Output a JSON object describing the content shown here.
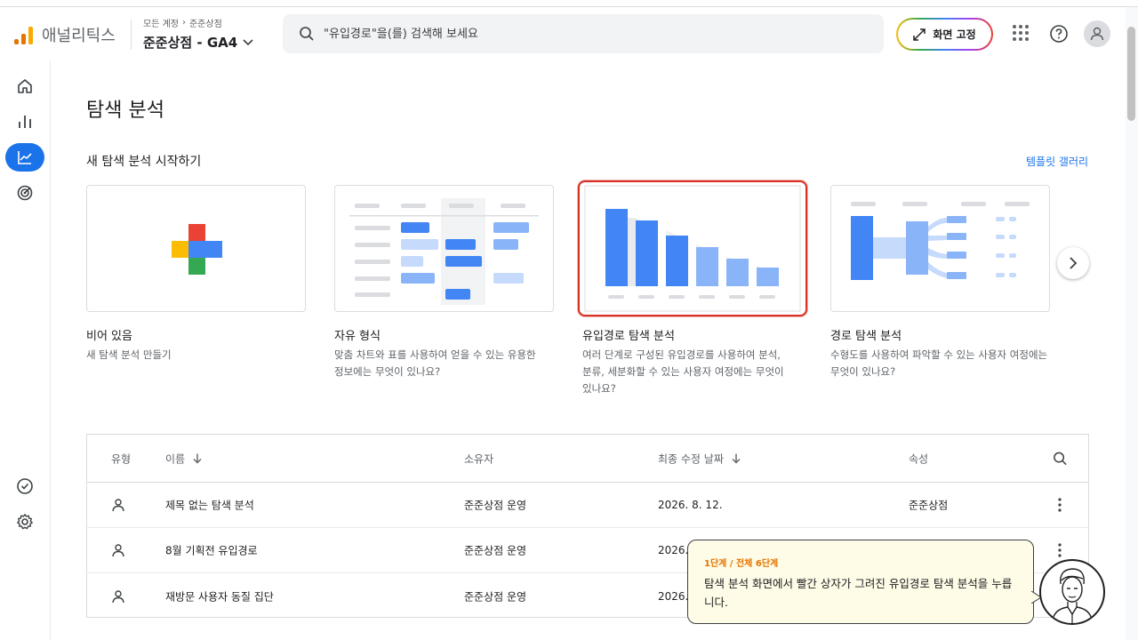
{
  "header": {
    "app_name": "애널리틱스",
    "breadcrumb": [
      "모든 계정",
      "준준상점"
    ],
    "property_name": "준준상점 - GA4",
    "search_placeholder": "\"유입경로\"을(를) 검색해 보세요",
    "pin_label": "화면 고정"
  },
  "rail": {
    "items": [
      "home-icon",
      "reports-icon",
      "explore-icon",
      "advertising-icon"
    ],
    "bottom": [
      "check-circle-icon",
      "gear-icon"
    ]
  },
  "main": {
    "title": "탐색 분석",
    "section_title": "새 탐색 분석 시작하기",
    "gallery_link": "템플릿 갤러리",
    "cards": [
      {
        "title": "비어 있음",
        "desc": "새 탐색 분석 만들기"
      },
      {
        "title": "자유 형식",
        "desc": "맞춤 차트와 표를 사용하여 얻을 수 있는 유용한 정보에는 무엇이 있나요?"
      },
      {
        "title": "유입경로 탐색 분석",
        "desc": "여러 단계로 구성된 유입경로를 사용하여 분석, 분류, 세분화할 수 있는 사용자 여정에는 무엇이 있나요?"
      },
      {
        "title": "경로 탐색 분석",
        "desc": "수형도를 사용하여 파악할 수 있는 사용자 여정에는 무엇이 있나요?"
      }
    ]
  },
  "table": {
    "columns": [
      "유형",
      "이름",
      "소유자",
      "최종 수정 날짜",
      "속성"
    ],
    "rows": [
      {
        "name": "제목 없는 탐색 분석",
        "owner": "준준상점 운영",
        "date": "2026. 8. 12.",
        "property": "준준상점"
      },
      {
        "name": "8월 기획전 유입경로",
        "owner": "준준상점 운영",
        "date": "2026.",
        "property": ""
      },
      {
        "name": "재방문 사용자 동질 집단",
        "owner": "준준상점 운영",
        "date": "2026.",
        "property": ""
      }
    ]
  },
  "tooltip": {
    "step": "1단계 / 전체 6단계",
    "message": "탐색 분석 화면에서 빨간 상자가 그려진 유입경로 탐색 분석을 누릅니다."
  },
  "colors": {
    "accent": "#1a73e8",
    "highlight": "#d93025",
    "step_text": "#e37400",
    "tooltip_bg": "#fefbe6"
  }
}
